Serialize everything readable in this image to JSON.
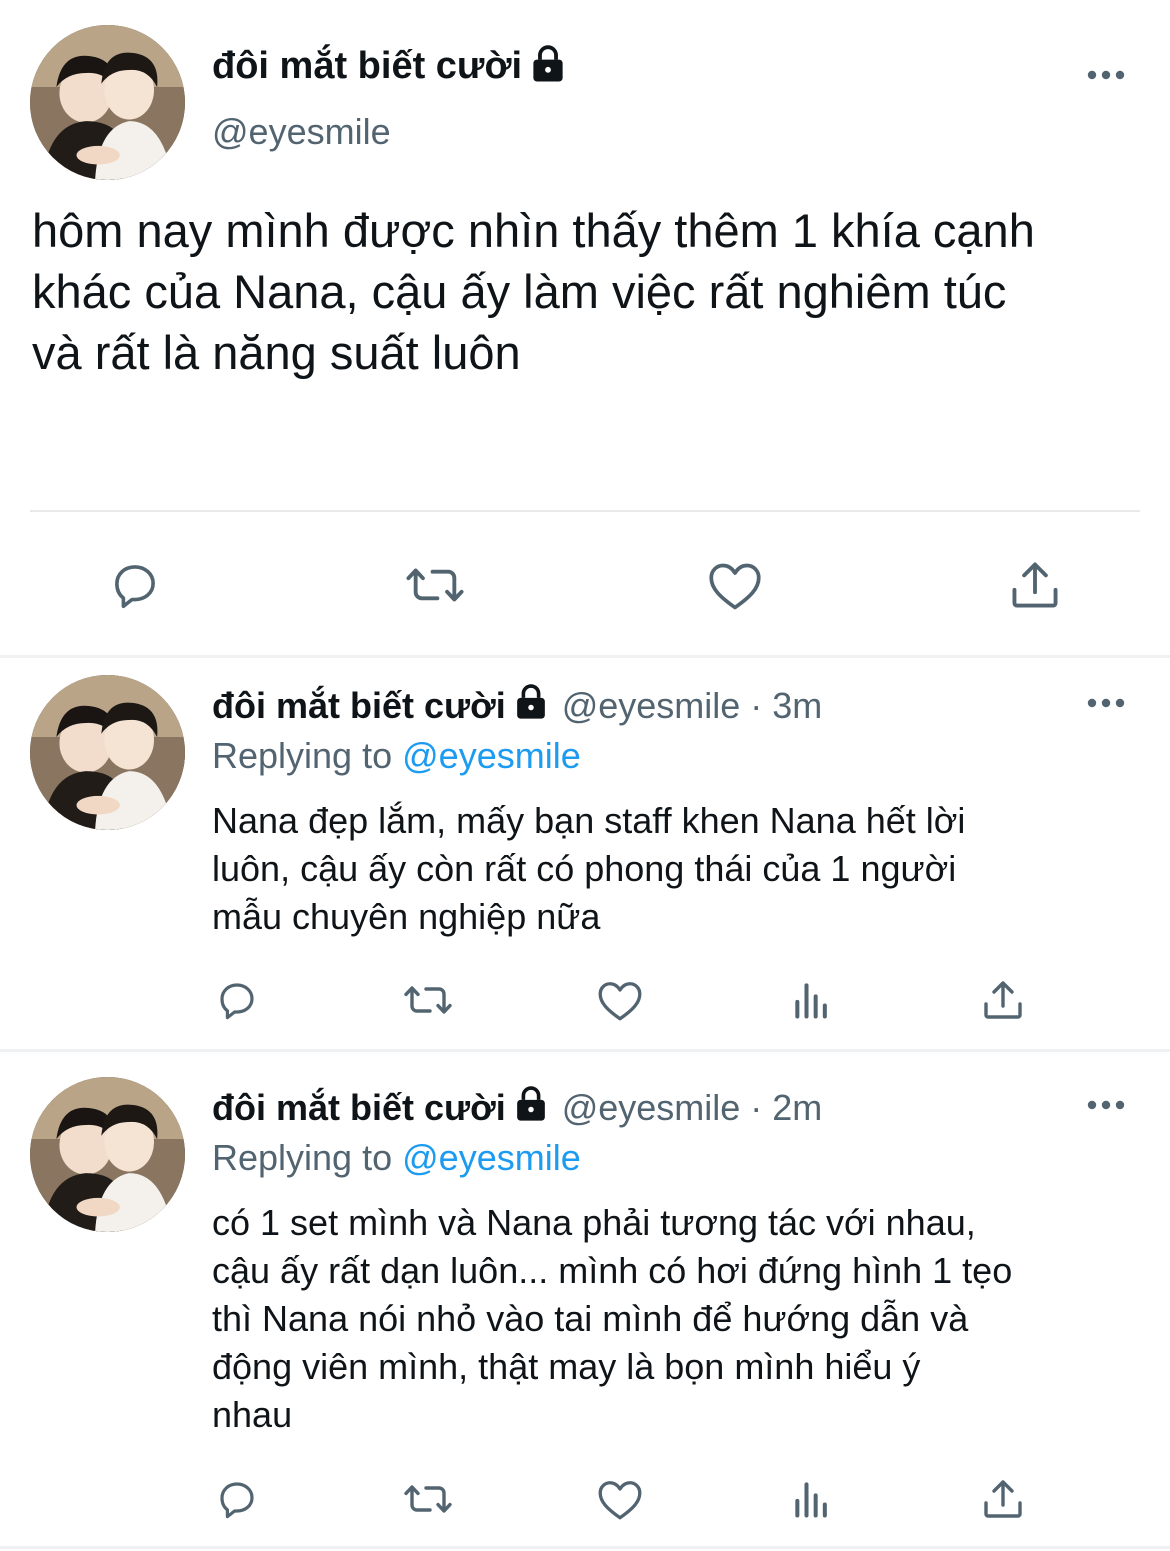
{
  "main_tweet": {
    "display_name": "đôi mắt biết cười",
    "handle": "@eyesmile",
    "text_lines": [
      "hôm nay mình được nhìn thấy thêm 1 khía cạnh",
      "khác của Nana, cậu ấy làm việc rất nghiêm túc",
      "và rất là năng suất luôn"
    ],
    "icons": {
      "lock": "lock-icon",
      "more": "more-options-icon",
      "reply": "reply-icon",
      "retweet": "retweet-icon",
      "like": "like-icon",
      "share": "share-icon"
    }
  },
  "replies": [
    {
      "display_name": "đôi mắt biết cười",
      "handle": "@eyesmile",
      "time": "· 3m",
      "replying_prefix": "Replying to",
      "replying_to": "@eyesmile",
      "text_lines": [
        "Nana đẹp lắm, mấy bạn staff khen Nana hết lời",
        "luôn, cậu ấy còn rất có phong thái của 1 người",
        "mẫu chuyên nghiệp nữa"
      ]
    },
    {
      "display_name": "đôi mắt biết cười",
      "handle": "@eyesmile",
      "time": "· 2m",
      "replying_prefix": "Replying to",
      "replying_to": "@eyesmile",
      "text_lines": [
        "có 1 set mình và Nana phải tương tác với nhau,",
        "cậu ấy rất dạn luôn... mình có hơi đứng hình 1 tẹo",
        "thì Nana nói nhỏ vào tai mình để hướng dẫn và",
        "động viên mình, thật may là bọn mình hiểu ý",
        "nhau"
      ]
    }
  ],
  "colors": {
    "text": "#0f1419",
    "secondary": "#536471",
    "accent": "#1d9bf0",
    "divider": "#e7e9ea"
  }
}
